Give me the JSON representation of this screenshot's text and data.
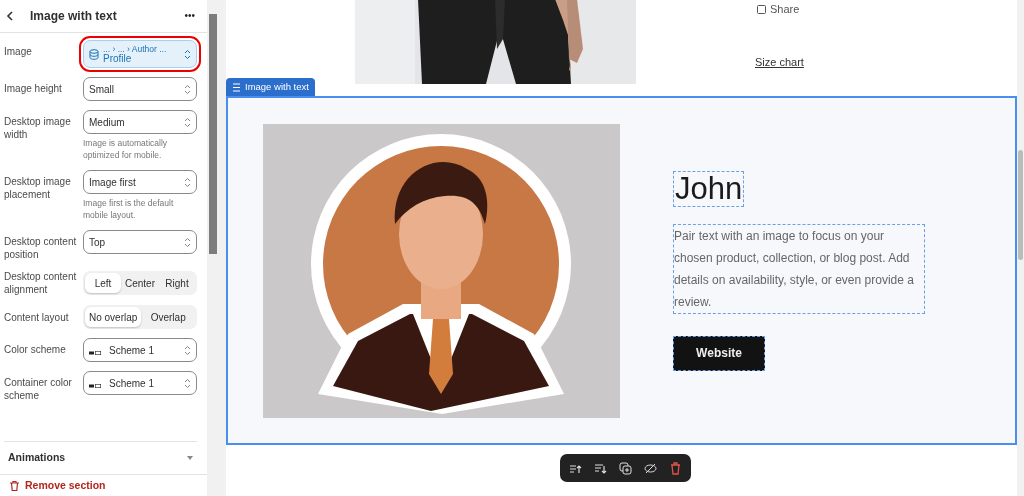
{
  "panel": {
    "title": "Image with text",
    "menu": "•••",
    "settings": [
      {
        "kind": "source",
        "label": "Image",
        "path": "... › ... › Author ...",
        "value": "Profile",
        "highlighted": true
      },
      {
        "kind": "select",
        "label": "Image height",
        "value": "Small"
      },
      {
        "kind": "select",
        "label": "Desktop image width",
        "value": "Medium",
        "help": "Image is automatically optimized for mobile."
      },
      {
        "kind": "select",
        "label": "Desktop image placement",
        "value": "Image first",
        "help": "Image first is the default mobile layout."
      },
      {
        "kind": "select",
        "label": "Desktop content position",
        "value": "Top"
      },
      {
        "kind": "segmented",
        "label": "Desktop content alignment",
        "options": [
          {
            "label": "Left",
            "selected": true
          },
          {
            "label": "Center",
            "selected": false
          },
          {
            "label": "Right",
            "selected": false
          }
        ]
      },
      {
        "kind": "segmented",
        "label": "Content layout",
        "options": [
          {
            "label": "No overlap",
            "selected": true
          },
          {
            "label": "Overlap",
            "selected": false
          }
        ]
      },
      {
        "kind": "scheme",
        "label": "Color scheme",
        "value": "Scheme 1"
      },
      {
        "kind": "scheme",
        "label": "Container color scheme",
        "value": "Scheme 1"
      }
    ],
    "section_heading": "Animations",
    "remove": "Remove section"
  },
  "preview": {
    "share": "Share",
    "size_chart": "Size chart",
    "section_tag": "Image with text",
    "heading": "John",
    "body": "Pair text with an image to focus on your chosen product, collection, or blog post. Add details on availability, style, or even provide a review.",
    "button": "Website"
  }
}
